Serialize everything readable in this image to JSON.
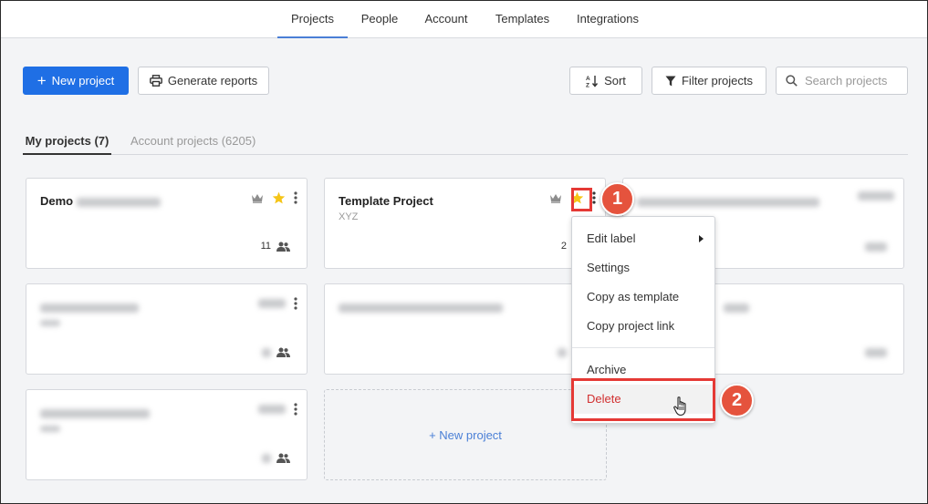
{
  "nav": {
    "tabs": [
      {
        "label": "Projects",
        "active": true
      },
      {
        "label": "People",
        "active": false
      },
      {
        "label": "Account",
        "active": false
      },
      {
        "label": "Templates",
        "active": false
      },
      {
        "label": "Integrations",
        "active": false
      }
    ]
  },
  "toolbar": {
    "new_project_label": "New project",
    "generate_reports_label": "Generate reports",
    "sort_label": "Sort",
    "filter_label": "Filter projects",
    "search_placeholder": "Search projects"
  },
  "subtabs": [
    {
      "label": "My projects (7)",
      "active": true
    },
    {
      "label": "Account projects (6205)",
      "active": false
    }
  ],
  "projects": [
    {
      "title": "Demo",
      "member_count": "11",
      "starred": true
    },
    {
      "title": "Template Project",
      "subtitle": "XYZ",
      "member_count": "2",
      "starred": true
    }
  ],
  "new_project_card_label": "+ New project",
  "context_menu": {
    "items": [
      "Edit label",
      "Settings",
      "Copy as template",
      "Copy project link",
      "Archive",
      "Delete"
    ]
  },
  "annotations": {
    "step1": "1",
    "step2": "2"
  },
  "colors": {
    "primary": "#1f6fe5",
    "accent_tab": "#4a7fd6",
    "star": "#f5c518",
    "danger": "#d12f2f",
    "highlight": "#e53935",
    "badge": "#e5533d"
  }
}
